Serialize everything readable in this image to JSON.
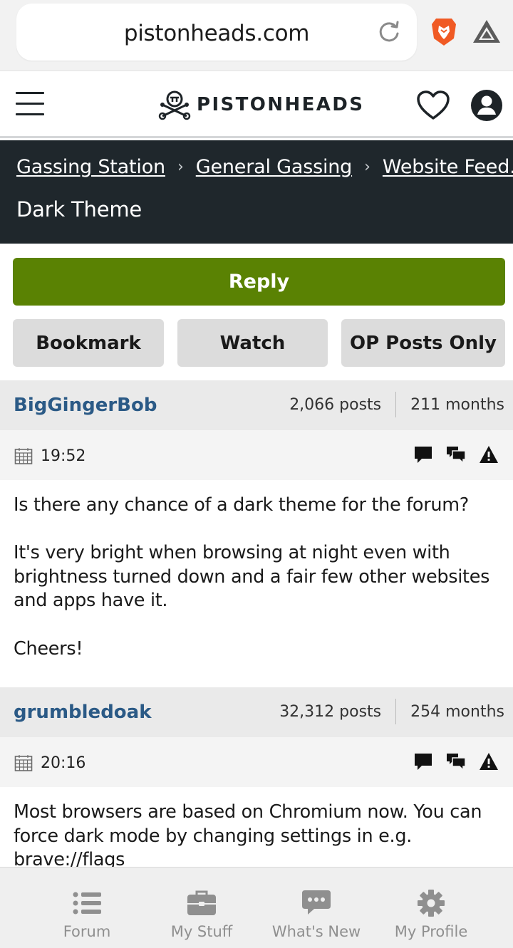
{
  "browser": {
    "url": "pistonheads.com"
  },
  "header": {
    "logo_text": "PISTONHEADS"
  },
  "breadcrumb": {
    "items": [
      "Gassing Station",
      "General Gassing",
      "Website Feed..."
    ],
    "separator": "›",
    "thread_title": "Dark Theme"
  },
  "actions": {
    "reply": "Reply",
    "bookmark": "Bookmark",
    "watch": "Watch",
    "op_posts_only": "OP Posts Only"
  },
  "posts": [
    {
      "author": "BigGingerBob",
      "posts": "2,066 posts",
      "months": "211 months",
      "time": "19:52",
      "body": [
        "Is there any chance of a dark theme for the forum?",
        "It's very bright when browsing at night even with brightness turned down and a fair few other websites and apps have it.",
        "Cheers!"
      ]
    },
    {
      "author": "grumbledoak",
      "posts": "32,312 posts",
      "months": "254 months",
      "time": "20:16",
      "body": [
        "Most browsers are based on Chromium now. You can force dark mode by changing settings in e.g. brave://flags"
      ]
    }
  ],
  "bottom_nav": {
    "items": [
      "Forum",
      "My Stuff",
      "What's New",
      "My Profile"
    ]
  },
  "icons": {
    "browser": [
      "reload-icon",
      "brave-lion-icon",
      "bat-triangle-icon"
    ],
    "header": [
      "hamburger-menu-icon",
      "pistonheads-logo-icon",
      "heart-icon",
      "user-account-icon"
    ],
    "post": [
      "calendar-icon",
      "reply-bubble-icon",
      "quote-bubbles-icon",
      "report-warning-icon"
    ],
    "nav": [
      "forum-list-icon",
      "briefcase-icon",
      "chat-bubble-icon",
      "gear-icon"
    ]
  },
  "colors": {
    "reply_green": "#5a8203",
    "breadcrumb_bg": "#1f272c",
    "author_blue": "#2b5a86",
    "button_gray": "#dcdcdc",
    "brave_orange": "#f05a24"
  }
}
